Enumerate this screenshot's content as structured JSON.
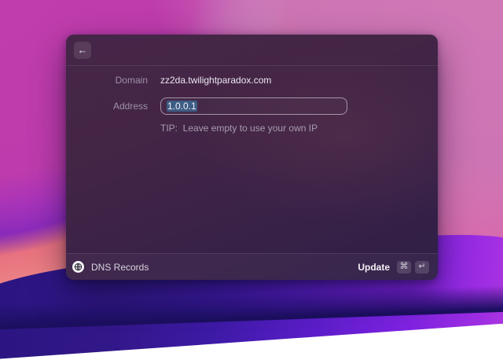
{
  "window": {
    "header": {
      "back_icon": "←"
    },
    "form": {
      "rows": [
        {
          "label": "Domain",
          "value": "zz2da.twilightparadox.com"
        },
        {
          "label": "Address",
          "value": "1.0.0.1"
        }
      ],
      "tip": "TIP:  Leave empty to use your own IP"
    },
    "footer": {
      "app_name": "DNS Records",
      "action": {
        "label": "Update",
        "shortcut": [
          "⌘",
          "↵"
        ]
      }
    }
  },
  "colors": {
    "selection_highlight": "#3d5d85",
    "window_tint": "#3f2346",
    "wallpaper_pink": "#da5fa8",
    "wallpaper_indigo": "#2a1480"
  }
}
